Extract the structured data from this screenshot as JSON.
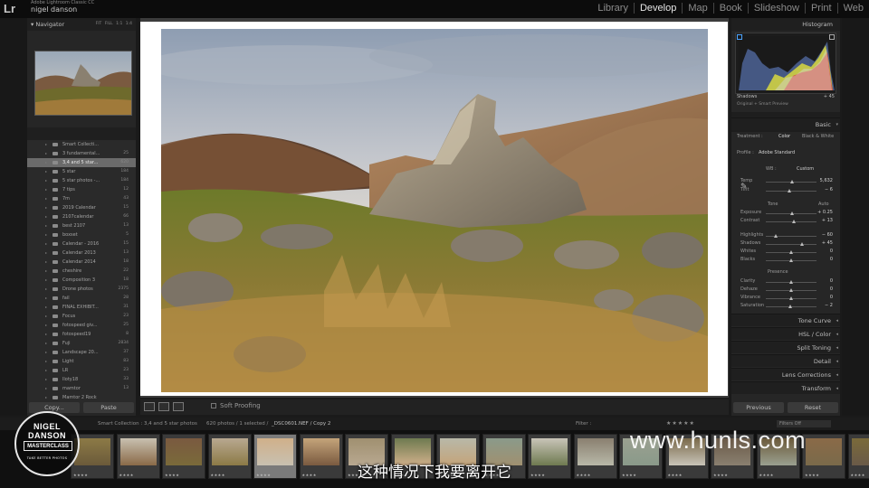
{
  "app": {
    "logo": "Lr",
    "subtitle": "Adobe Lightroom Classic CC",
    "user": "nigel danson"
  },
  "modules": [
    "Library",
    "Develop",
    "Map",
    "Book",
    "Slideshow",
    "Print",
    "Web"
  ],
  "active_module": "Develop",
  "navigator": {
    "title": "Navigator",
    "zoom_options": "FIT  FILL  1:1  1:4"
  },
  "collections": [
    {
      "label": "Smart Collecti...",
      "count": ""
    },
    {
      "label": "3 fundamental...",
      "count": "25"
    },
    {
      "label": "3,4 and 5 star...",
      "count": "620",
      "selected": true
    },
    {
      "label": "5 star",
      "count": "184"
    },
    {
      "label": "5 star photos -...",
      "count": "184"
    },
    {
      "label": "7 tips",
      "count": "12"
    },
    {
      "label": "7m",
      "count": "43"
    },
    {
      "label": "2019 Calendar",
      "count": "15"
    },
    {
      "label": "2107calendar",
      "count": "66"
    },
    {
      "label": "best 2107",
      "count": "13"
    },
    {
      "label": "boxset",
      "count": "5"
    },
    {
      "label": "Calendar - 2016",
      "count": "15"
    },
    {
      "label": "Calendar 2013",
      "count": "13"
    },
    {
      "label": "Calendar 2014",
      "count": "18"
    },
    {
      "label": "cheshire",
      "count": "22"
    },
    {
      "label": "Composition 3",
      "count": "18"
    },
    {
      "label": "Drone photos",
      "count": "2375"
    },
    {
      "label": "fail",
      "count": "28"
    },
    {
      "label": "FINAL EXHIBIT...",
      "count": "31"
    },
    {
      "label": "Focus",
      "count": "23"
    },
    {
      "label": "fotospeed giv...",
      "count": "25"
    },
    {
      "label": "fotospeed19",
      "count": "8"
    },
    {
      "label": "Fuji",
      "count": "2834"
    },
    {
      "label": "Landscape 20...",
      "count": "37"
    },
    {
      "label": "Light",
      "count": "83"
    },
    {
      "label": "LR",
      "count": "23"
    },
    {
      "label": "lloty18",
      "count": "33"
    },
    {
      "label": "mamtor",
      "count": "13"
    },
    {
      "label": "Mamtor 2 Rock",
      "count": ""
    }
  ],
  "left_buttons": {
    "copy": "Copy...",
    "paste": "Paste"
  },
  "toolbar": {
    "soft_proofing": "Soft Proofing"
  },
  "histogram": {
    "title": "Histogram",
    "shadows_label": "Shadows",
    "shadows_value": "+ 45",
    "preview": "Original + Smart Preview"
  },
  "basic": {
    "title": "Basic",
    "treatment_label": "Treatment :",
    "treatment_color": "Color",
    "treatment_bw": "Black & White",
    "profile_label": "Profile :",
    "profile_value": "Adobe Standard",
    "wb_label": "WB :",
    "wb_value": "Custom",
    "sliders": [
      {
        "label": "Temp",
        "value": "5,632",
        "pos": 0.52
      },
      {
        "label": "Tint",
        "value": "− 6",
        "pos": 0.48
      },
      {
        "label": "Exposure",
        "value": "+ 0.25",
        "pos": 0.53
      },
      {
        "label": "Contrast",
        "value": "+ 13",
        "pos": 0.56
      },
      {
        "label": "Highlights",
        "value": "− 60",
        "pos": 0.2
      },
      {
        "label": "Shadows",
        "value": "+ 45",
        "pos": 0.72
      },
      {
        "label": "Whites",
        "value": "0",
        "pos": 0.5
      },
      {
        "label": "Blacks",
        "value": "0",
        "pos": 0.5
      },
      {
        "label": "Clarity",
        "value": "0",
        "pos": 0.5
      },
      {
        "label": "Dehaze",
        "value": "0",
        "pos": 0.5
      },
      {
        "label": "Vibrance",
        "value": "0",
        "pos": 0.5
      },
      {
        "label": "Saturation",
        "value": "− 2",
        "pos": 0.49
      }
    ],
    "tone_label": "Tone",
    "tone_auto": "Auto",
    "presence_label": "Presence"
  },
  "panels": [
    "Tone Curve",
    "HSL / Color",
    "Split Toning",
    "Detail",
    "Lens Corrections",
    "Transform"
  ],
  "right_buttons": {
    "previous": "Previous",
    "reset": "Reset"
  },
  "filmstrip_bar": {
    "source": "Smart Collection : 3,4 and 5 star photos",
    "count": "620 photos / 1 selected /",
    "file": "_DSC0601.NEF / Copy 2",
    "filter": "Filter :",
    "stars": "★★★★★",
    "filter_off": "Filters Off"
  },
  "badge": {
    "name": "NIGEL DANSON",
    "masterclass": "MASTERCLASS",
    "tagline": "TAKE BETTER PHOTOS"
  },
  "watermark": "www.hunls.com",
  "subtitle": "这种情况下我要离开它",
  "colors": {
    "accent": "#e6e6e6",
    "panel": "#262626",
    "selected_row": "#6b6b6b"
  }
}
